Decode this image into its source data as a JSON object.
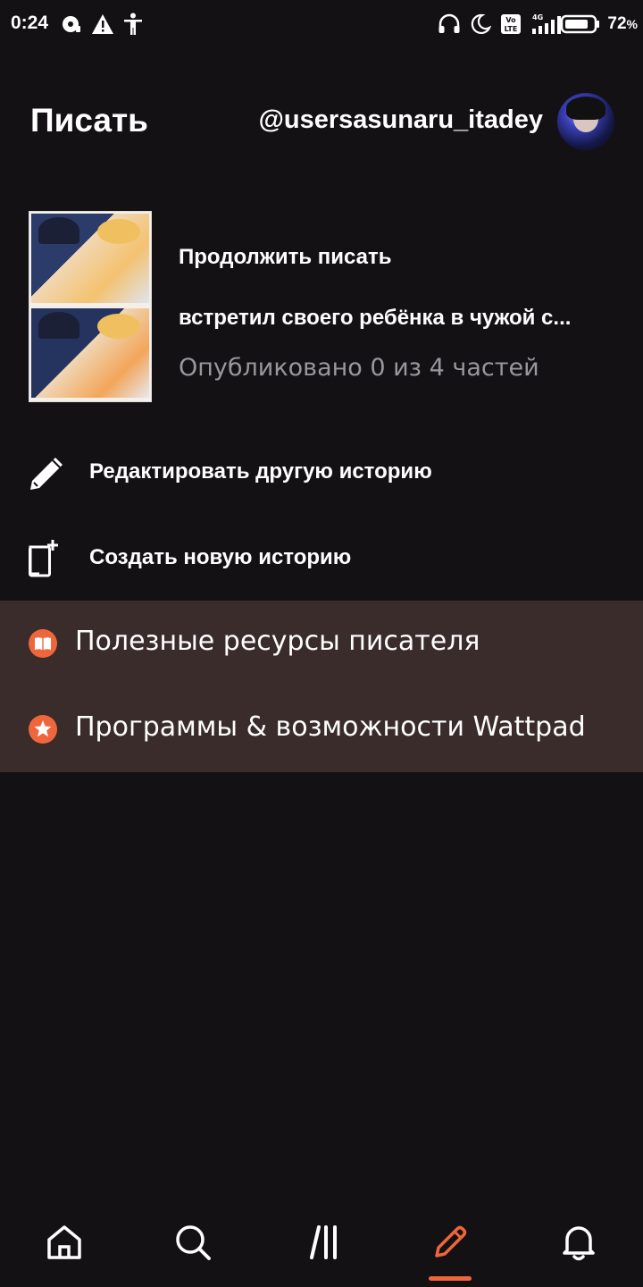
{
  "status_bar": {
    "time": "0:24",
    "battery_pct": "72",
    "battery_suffix": "%",
    "left_icons": [
      "disc-icon",
      "warning-icon",
      "accessibility-icon"
    ],
    "right_icons": [
      "headphones-icon",
      "moon-icon",
      "volte-icon",
      "signal-4g-icon",
      "battery-icon"
    ]
  },
  "header": {
    "title": "Писать",
    "username": "@usersasunaru_itadey"
  },
  "continue_writing": {
    "label": "Продолжить писать",
    "story_title": "встретил своего ребёнка в чужой с...",
    "meta": "Опубликовано 0 из 4 частей"
  },
  "actions": [
    {
      "label": "Редактировать другую историю",
      "icon": "pencil-icon"
    },
    {
      "label": "Создать новую историю",
      "icon": "new-story-icon"
    }
  ],
  "resources": [
    {
      "label": "Полезные ресурсы писателя",
      "icon": "book-icon"
    },
    {
      "label": "Программы & возможности Wattpad",
      "icon": "star-icon"
    }
  ],
  "bottom_nav": {
    "items": [
      "home-icon",
      "search-icon",
      "library-icon",
      "write-icon",
      "notifications-icon"
    ],
    "active": "write-icon"
  },
  "colors": {
    "background": "#141115",
    "resources_bg": "#3a2c2a",
    "accent": "#f0663c",
    "muted_text": "#9a979c"
  }
}
